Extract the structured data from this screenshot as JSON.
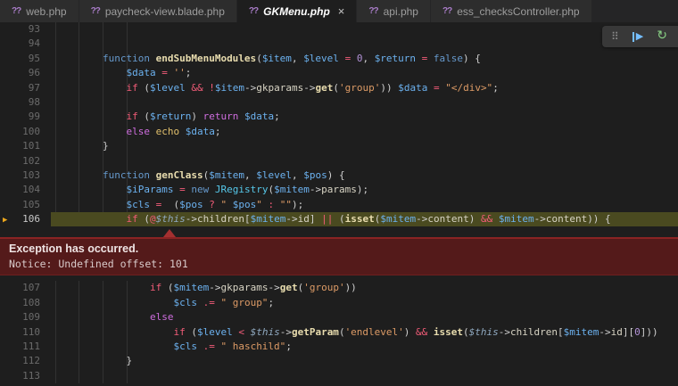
{
  "tabs": {
    "php_icon": "??",
    "close_icon": "×",
    "items": [
      {
        "label": "web.php",
        "active": false
      },
      {
        "label": "paycheck-view.blade.php",
        "active": false
      },
      {
        "label": "GKMenu.php",
        "active": true
      },
      {
        "label": "api.php",
        "active": false
      },
      {
        "label": "ess_checksController.php",
        "active": false
      }
    ]
  },
  "debug_toolbar": {
    "grip_icon": "⠿",
    "continue_icon": "▶",
    "restart_icon": "↻"
  },
  "exception": {
    "title": "Exception has occurred.",
    "message": "Notice: Undefined offset: 101"
  },
  "editor": {
    "current_line": 106,
    "gutter_arrow_icon": "▶",
    "colors": {
      "background": "#1e1e1e",
      "tab_inactive_bg": "#2d2d2d",
      "php_icon_purple": "#a87cc7",
      "current_line_highlight": "#4a4a20",
      "gutter_arrow_yellow": "#eda71d",
      "exception_bg": "#541a1a",
      "exception_border": "#8a2424",
      "continue_icon_blue": "#75beff",
      "restart_icon_green": "#89d185"
    },
    "sections": [
      {
        "name": "top",
        "lines": [
          {
            "num": 93,
            "tokens": []
          },
          {
            "num": 94,
            "tokens": []
          },
          {
            "num": 95,
            "tokens": [
              [
                "pl",
                "        "
              ],
              [
                "kw",
                "function"
              ],
              [
                "pl",
                " "
              ],
              [
                "fn",
                "endSubMenuModules"
              ],
              [
                "pl",
                "("
              ],
              [
                "var",
                "$item"
              ],
              [
                "pl",
                ", "
              ],
              [
                "var",
                "$level"
              ],
              [
                "pl",
                " "
              ],
              [
                "op",
                "="
              ],
              [
                "pl",
                " "
              ],
              [
                "num",
                "0"
              ],
              [
                "pl",
                ", "
              ],
              [
                "var",
                "$return"
              ],
              [
                "pl",
                " "
              ],
              [
                "op",
                "="
              ],
              [
                "pl",
                " "
              ],
              [
                "kw",
                "false"
              ],
              [
                "pl",
                ") {"
              ]
            ]
          },
          {
            "num": 96,
            "tokens": [
              [
                "pl",
                "            "
              ],
              [
                "var",
                "$data"
              ],
              [
                "pl",
                " "
              ],
              [
                "op",
                "="
              ],
              [
                "pl",
                " "
              ],
              [
                "str",
                "''"
              ],
              [
                "pl",
                ";"
              ]
            ]
          },
          {
            "num": 97,
            "tokens": [
              [
                "pl",
                "            "
              ],
              [
                "op",
                "if"
              ],
              [
                "pl",
                " ("
              ],
              [
                "var",
                "$level"
              ],
              [
                "pl",
                " "
              ],
              [
                "op",
                "&&"
              ],
              [
                "pl",
                " "
              ],
              [
                "op",
                "!"
              ],
              [
                "var",
                "$item"
              ],
              [
                "pl",
                "->"
              ],
              [
                "prop",
                "gkparams"
              ],
              [
                "pl",
                "->"
              ],
              [
                "fn",
                "get"
              ],
              [
                "pl",
                "("
              ],
              [
                "str",
                "'group'"
              ],
              [
                "pl",
                ")) "
              ],
              [
                "var",
                "$data"
              ],
              [
                "pl",
                " "
              ],
              [
                "op",
                "="
              ],
              [
                "pl",
                " "
              ],
              [
                "str",
                "\"</div>\""
              ],
              [
                "pl",
                ";"
              ]
            ]
          },
          {
            "num": 98,
            "tokens": []
          },
          {
            "num": 99,
            "tokens": [
              [
                "pl",
                "            "
              ],
              [
                "op",
                "if"
              ],
              [
                "pl",
                " ("
              ],
              [
                "var",
                "$return"
              ],
              [
                "pl",
                ") "
              ],
              [
                "ctrl",
                "return"
              ],
              [
                "pl",
                " "
              ],
              [
                "var",
                "$data"
              ],
              [
                "pl",
                ";"
              ]
            ]
          },
          {
            "num": 100,
            "tokens": [
              [
                "pl",
                "            "
              ],
              [
                "ctrl",
                "else"
              ],
              [
                "pl",
                " "
              ],
              [
                "echo",
                "echo"
              ],
              [
                "pl",
                " "
              ],
              [
                "var",
                "$data"
              ],
              [
                "pl",
                ";"
              ]
            ]
          },
          {
            "num": 101,
            "tokens": [
              [
                "pl",
                "        }"
              ]
            ]
          },
          {
            "num": 102,
            "tokens": []
          },
          {
            "num": 103,
            "tokens": [
              [
                "pl",
                "        "
              ],
              [
                "kw",
                "function"
              ],
              [
                "pl",
                " "
              ],
              [
                "fn",
                "genClass"
              ],
              [
                "pl",
                "("
              ],
              [
                "var",
                "$mitem"
              ],
              [
                "pl",
                ", "
              ],
              [
                "var",
                "$level"
              ],
              [
                "pl",
                ", "
              ],
              [
                "var",
                "$pos"
              ],
              [
                "pl",
                ") {"
              ]
            ]
          },
          {
            "num": 104,
            "tokens": [
              [
                "pl",
                "            "
              ],
              [
                "var",
                "$iParams"
              ],
              [
                "pl",
                " "
              ],
              [
                "op",
                "="
              ],
              [
                "pl",
                " "
              ],
              [
                "kw",
                "new"
              ],
              [
                "pl",
                " "
              ],
              [
                "cls",
                "JRegistry"
              ],
              [
                "pl",
                "("
              ],
              [
                "var",
                "$mitem"
              ],
              [
                "pl",
                "->"
              ],
              [
                "prop",
                "params"
              ],
              [
                "pl",
                ");"
              ]
            ]
          },
          {
            "num": 105,
            "tokens": [
              [
                "pl",
                "            "
              ],
              [
                "var",
                "$cls"
              ],
              [
                "pl",
                " "
              ],
              [
                "op",
                "="
              ],
              [
                "pl",
                "  ("
              ],
              [
                "var",
                "$pos"
              ],
              [
                "pl",
                " "
              ],
              [
                "op",
                "?"
              ],
              [
                "pl",
                " "
              ],
              [
                "str",
                "\" "
              ],
              [
                "var",
                "$pos"
              ],
              [
                "str",
                "\""
              ],
              [
                "pl",
                " "
              ],
              [
                "op",
                ":"
              ],
              [
                "pl",
                " "
              ],
              [
                "str",
                "\"\""
              ],
              [
                "pl",
                ");"
              ]
            ]
          },
          {
            "num": 106,
            "current": true,
            "tokens": [
              [
                "pl",
                "            "
              ],
              [
                "op",
                "if"
              ],
              [
                "pl",
                " ("
              ],
              [
                "op",
                "@"
              ],
              [
                "this",
                "$this"
              ],
              [
                "pl",
                "->"
              ],
              [
                "prop",
                "children"
              ],
              [
                "pl",
                "["
              ],
              [
                "var",
                "$mitem"
              ],
              [
                "pl",
                "->"
              ],
              [
                "prop",
                "id"
              ],
              [
                "pl",
                "] "
              ],
              [
                "op",
                "||"
              ],
              [
                "pl",
                " ("
              ],
              [
                "fn",
                "isset"
              ],
              [
                "pl",
                "("
              ],
              [
                "var",
                "$mitem"
              ],
              [
                "pl",
                "->"
              ],
              [
                "prop",
                "content"
              ],
              [
                "pl",
                ") "
              ],
              [
                "op",
                "&&"
              ],
              [
                "pl",
                " "
              ],
              [
                "var",
                "$mitem"
              ],
              [
                "pl",
                "->"
              ],
              [
                "prop",
                "content"
              ],
              [
                "pl",
                ")) {"
              ]
            ]
          }
        ]
      },
      {
        "name": "bottom",
        "lines": [
          {
            "num": 107,
            "tokens": [
              [
                "pl",
                "                "
              ],
              [
                "op",
                "if"
              ],
              [
                "pl",
                " ("
              ],
              [
                "var",
                "$mitem"
              ],
              [
                "pl",
                "->"
              ],
              [
                "prop",
                "gkparams"
              ],
              [
                "pl",
                "->"
              ],
              [
                "fn",
                "get"
              ],
              [
                "pl",
                "("
              ],
              [
                "str",
                "'group'"
              ],
              [
                "pl",
                "))"
              ]
            ]
          },
          {
            "num": 108,
            "tokens": [
              [
                "pl",
                "                    "
              ],
              [
                "var",
                "$cls"
              ],
              [
                "pl",
                " "
              ],
              [
                "op",
                ".="
              ],
              [
                "pl",
                " "
              ],
              [
                "str",
                "\" group\""
              ],
              [
                "pl",
                ";"
              ]
            ]
          },
          {
            "num": 109,
            "tokens": [
              [
                "pl",
                "                "
              ],
              [
                "ctrl",
                "else"
              ]
            ]
          },
          {
            "num": 110,
            "tokens": [
              [
                "pl",
                "                    "
              ],
              [
                "op",
                "if"
              ],
              [
                "pl",
                " ("
              ],
              [
                "var",
                "$level"
              ],
              [
                "pl",
                " "
              ],
              [
                "op",
                "<"
              ],
              [
                "pl",
                " "
              ],
              [
                "this",
                "$this"
              ],
              [
                "pl",
                "->"
              ],
              [
                "fn",
                "getParam"
              ],
              [
                "pl",
                "("
              ],
              [
                "str",
                "'endlevel'"
              ],
              [
                "pl",
                ") "
              ],
              [
                "op",
                "&&"
              ],
              [
                "pl",
                " "
              ],
              [
                "fn",
                "isset"
              ],
              [
                "pl",
                "("
              ],
              [
                "this",
                "$this"
              ],
              [
                "pl",
                "->"
              ],
              [
                "prop",
                "children"
              ],
              [
                "pl",
                "["
              ],
              [
                "var",
                "$mitem"
              ],
              [
                "pl",
                "->"
              ],
              [
                "prop",
                "id"
              ],
              [
                "pl",
                "]["
              ],
              [
                "num",
                "0"
              ],
              [
                "pl",
                "]))"
              ]
            ]
          },
          {
            "num": 111,
            "tokens": [
              [
                "pl",
                "                    "
              ],
              [
                "var",
                "$cls"
              ],
              [
                "pl",
                " "
              ],
              [
                "op",
                ".="
              ],
              [
                "pl",
                " "
              ],
              [
                "str",
                "\" haschild\""
              ],
              [
                "pl",
                ";"
              ]
            ]
          },
          {
            "num": 112,
            "tokens": [
              [
                "pl",
                "            }"
              ]
            ]
          },
          {
            "num": 113,
            "tokens": []
          }
        ]
      }
    ]
  }
}
